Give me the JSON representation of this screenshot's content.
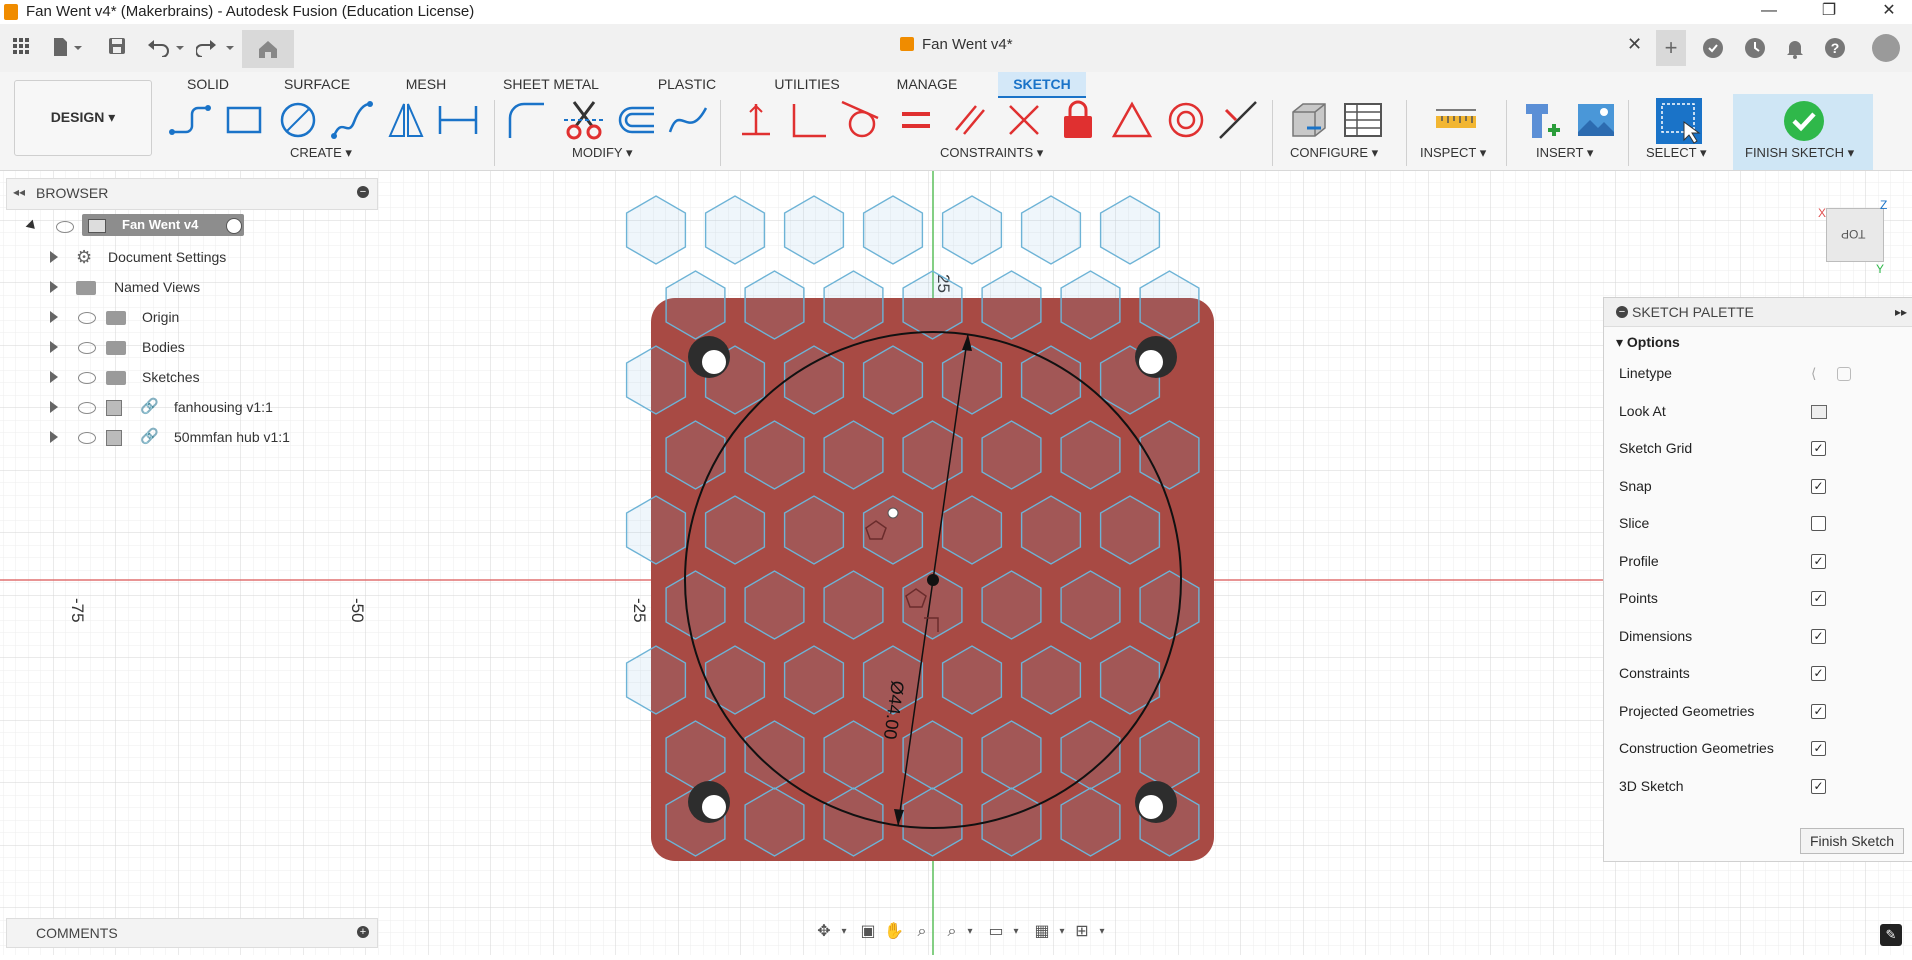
{
  "window": {
    "title": "Fan Went v4* (Makerbrains) - Autodesk Fusion (Education License)",
    "minimize": "—",
    "maximize": "❐",
    "close": "✕"
  },
  "tabbar": {
    "doc_tab": "Fan Went v4*",
    "close_tab": "✕",
    "new_tab": "+"
  },
  "ribbon": {
    "workspace": "DESIGN",
    "tabs": [
      "SOLID",
      "SURFACE",
      "MESH",
      "SHEET METAL",
      "PLASTIC",
      "UTILITIES",
      "MANAGE",
      "SKETCH"
    ],
    "active_tab": "SKETCH",
    "groups": {
      "create": "CREATE",
      "modify": "MODIFY",
      "constraints": "CONSTRAINTS",
      "configure": "CONFIGURE",
      "inspect": "INSPECT",
      "insert": "INSERT",
      "select": "SELECT",
      "finish": "FINISH SKETCH"
    }
  },
  "browser": {
    "header": "BROWSER",
    "root": "Fan Went v4",
    "items": [
      {
        "label": "Document Settings",
        "icon": "gear-icon"
      },
      {
        "label": "Named Views",
        "icon": "folder-icon"
      },
      {
        "label": "Origin",
        "icon": "folder-icon"
      },
      {
        "label": "Bodies",
        "icon": "folder-icon"
      },
      {
        "label": "Sketches",
        "icon": "folder-icon"
      },
      {
        "label": "fanhousing v1:1",
        "icon": "component-link-icon"
      },
      {
        "label": "50mmfan hub v1:1",
        "icon": "component-link-icon"
      }
    ]
  },
  "canvas": {
    "axis_labels": [
      "-75",
      "-50",
      "-25",
      "25"
    ],
    "dimension": "Ø44.00",
    "plate_color": "#a84a44",
    "hex_color": "#6db3d6",
    "viewcube": {
      "face": "TOP",
      "x": "X",
      "y": "Y",
      "z": "Z"
    }
  },
  "palette": {
    "header": "SKETCH PALETTE",
    "section": "Options",
    "rows": [
      {
        "label": "Linetype",
        "kind": "icons"
      },
      {
        "label": "Look At",
        "kind": "icon"
      },
      {
        "label": "Sketch Grid",
        "checked": true
      },
      {
        "label": "Snap",
        "checked": true
      },
      {
        "label": "Slice",
        "checked": false
      },
      {
        "label": "Profile",
        "checked": true
      },
      {
        "label": "Points",
        "checked": true
      },
      {
        "label": "Dimensions",
        "checked": true
      },
      {
        "label": "Constraints",
        "checked": true
      },
      {
        "label": "Projected Geometries",
        "checked": true
      },
      {
        "label": "Construction Geometries",
        "checked": true
      },
      {
        "label": "3D Sketch",
        "checked": true
      }
    ],
    "finish_button": "Finish Sketch"
  },
  "comments": {
    "header": "COMMENTS"
  }
}
